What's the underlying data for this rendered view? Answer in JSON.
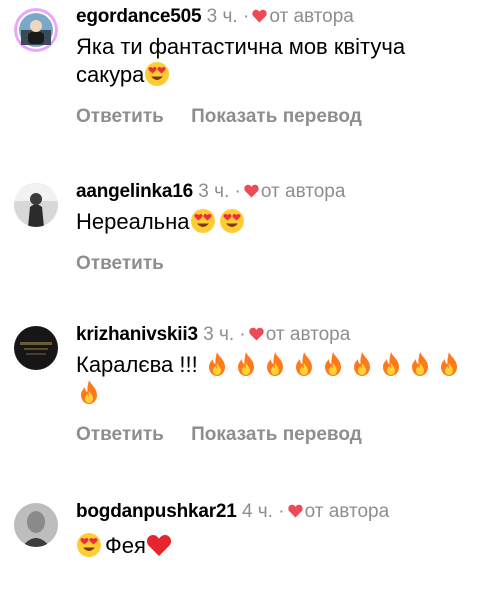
{
  "comments": [
    {
      "username": "egordance505",
      "time": "3 ч.",
      "sep": "·",
      "liked_by": "от автора",
      "text": "Яка ти фантастична мов квітуча сакура",
      "reply_label": "Ответить",
      "translate_label": "Показать перевод",
      "avatar_icon": "avatar-egordance505",
      "emoji": [
        "heart-eyes-emoji"
      ]
    },
    {
      "username": "aangelinka16",
      "time": "3 ч.",
      "sep": "·",
      "liked_by": "от автора",
      "text": "Нереальна",
      "reply_label": "Ответить",
      "avatar_icon": "avatar-aangelinka16",
      "emoji": [
        "heart-eyes-emoji",
        "heart-eyes-emoji"
      ]
    },
    {
      "username": "krizhanivskii3",
      "time": "3 ч.",
      "sep": "·",
      "liked_by": "от автора",
      "text": "Каралєва !!!",
      "reply_label": "Ответить",
      "translate_label": "Показать перевод",
      "avatar_icon": "avatar-krizhanivskii3",
      "emoji": [
        "fire-emoji",
        "fire-emoji",
        "fire-emoji",
        "fire-emoji",
        "fire-emoji",
        "fire-emoji",
        "fire-emoji",
        "fire-emoji",
        "fire-emoji",
        "fire-emoji"
      ]
    },
    {
      "username": "bogdanpushkar21",
      "time": "4 ч.",
      "sep": "·",
      "liked_by": "от автора",
      "text": "Фея",
      "avatar_icon": "avatar-bogdanpushkar21",
      "emoji": [
        "heart-eyes-emoji",
        "red-heart-emoji"
      ]
    }
  ],
  "colors": {
    "text": "#000000",
    "muted": "#8e8e8e",
    "heart": "#ed4956",
    "emoji_face": "#ffcc33",
    "fire": "#ff7a1a"
  }
}
